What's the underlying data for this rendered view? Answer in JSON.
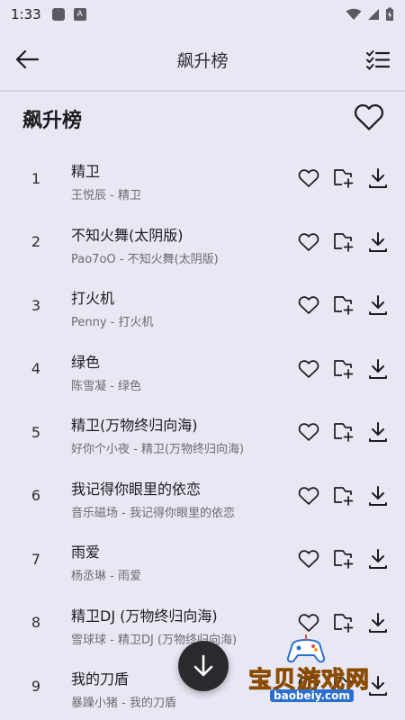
{
  "status": {
    "time": "1:33",
    "a_label": "A"
  },
  "app_bar": {
    "title": "飙升榜"
  },
  "header": {
    "title": "飙升榜"
  },
  "songs": [
    {
      "num": "1",
      "title": "精卫",
      "sub": "王悦辰 - 精卫"
    },
    {
      "num": "2",
      "title": "不知火舞(太阴版)",
      "sub": "Pao7oO - 不知火舞(太阴版)"
    },
    {
      "num": "3",
      "title": "打火机",
      "sub": "Penny - 打火机"
    },
    {
      "num": "4",
      "title": "绿色",
      "sub": "陈雪凝 - 绿色"
    },
    {
      "num": "5",
      "title": "精卫(万物终归向海)",
      "sub": "好你个小夜 - 精卫(万物终归向海)"
    },
    {
      "num": "6",
      "title": "我记得你眼里的依恋",
      "sub": "音乐磁场 - 我记得你眼里的依恋"
    },
    {
      "num": "7",
      "title": "雨爱",
      "sub": "杨丞琳 - 雨爱"
    },
    {
      "num": "8",
      "title": "精卫DJ (万物终归向海)",
      "sub": "雪球球 - 精卫DJ (万物终归向海)"
    },
    {
      "num": "9",
      "title": "我的刀盾",
      "sub": "暴躁小猪 - 我的刀盾"
    }
  ],
  "watermark": {
    "title": "宝贝游戏网",
    "url": "baobeiy.com"
  },
  "icons": {
    "back": "arrow-left-icon",
    "menu": "checklist-icon",
    "like": "heart-outline-icon",
    "add": "add-to-playlist-icon",
    "download": "download-icon",
    "fab": "arrow-down-icon"
  }
}
